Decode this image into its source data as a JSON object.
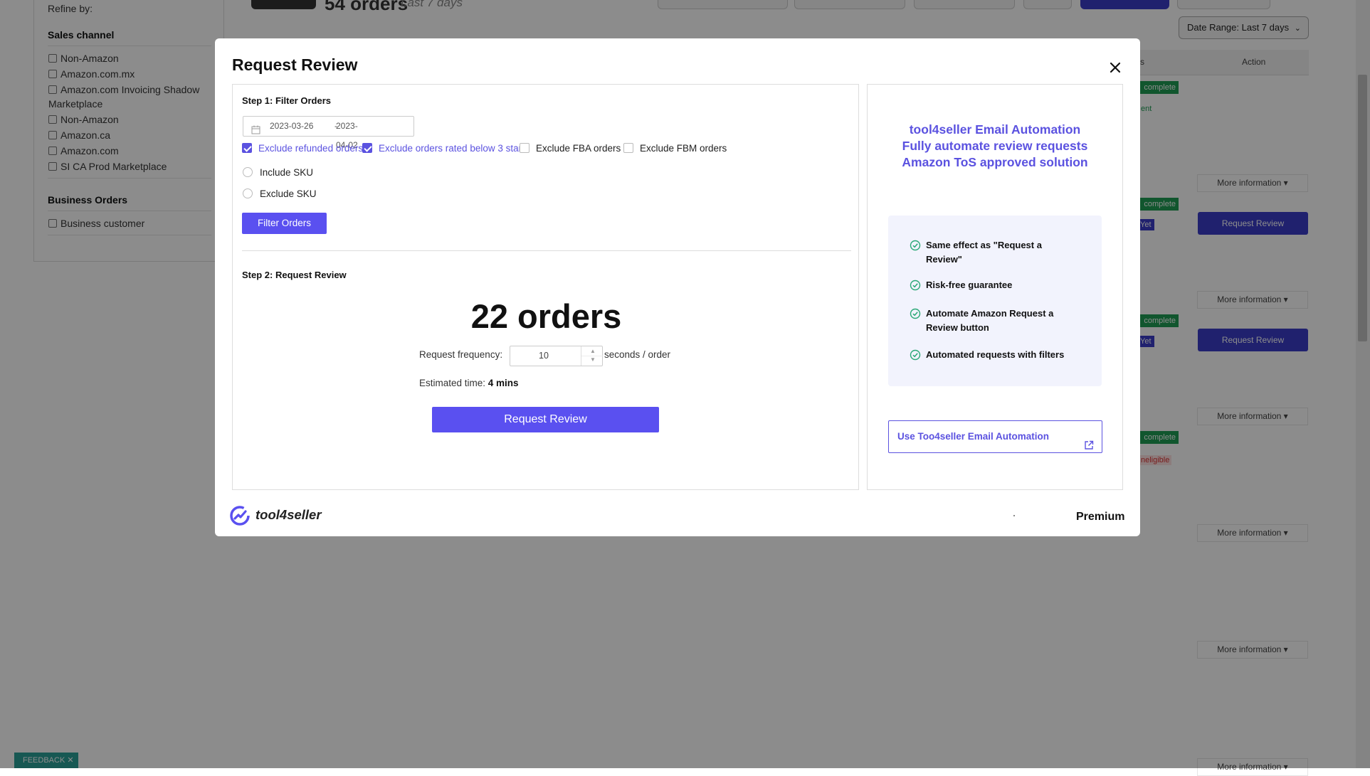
{
  "background": {
    "refine_by": "Refine by:",
    "sales_channel_title": "Sales channel",
    "sales_channels": [
      "Non-Amazon",
      "Amazon.com.mx",
      "Amazon.com Invoicing Shadow Marketplace",
      "Non-Amazon",
      "Amazon.ca",
      "Amazon.com",
      "SI CA Prod Marketplace"
    ],
    "business_orders_title": "Business Orders",
    "business_items": [
      "Business customer"
    ],
    "orders_title": "54 orders",
    "orders_subtitle": "Last 7 days",
    "date_range": "Date Range: Last 7 days",
    "col_action": "Action",
    "col_status_tail": "s",
    "more_information": "More information",
    "request_review": "Request Review",
    "status_complete": "complete",
    "status_sent": "ent",
    "status_yet": "Yet",
    "status_ineligible": "neligible",
    "feedback": "FEEDBACK"
  },
  "modal": {
    "title": "Request Review",
    "step1": {
      "title": "Step 1: Filter Orders",
      "date_start": "2023-03-26",
      "date_sep": "-",
      "date_end": "2023-04-02",
      "checkboxes": [
        {
          "label": "Exclude refunded orders",
          "checked": true
        },
        {
          "label": "Exclude orders rated below 3 stars",
          "checked": true
        },
        {
          "label": "Exclude FBA orders",
          "checked": false
        },
        {
          "label": "Exclude FBM orders",
          "checked": false
        }
      ],
      "radios": [
        "Include SKU",
        "Exclude SKU"
      ],
      "filter_button": "Filter Orders"
    },
    "step2": {
      "title": "Step 2: Request Review",
      "order_count": "22 orders",
      "frequency_label": "Request frequency:",
      "frequency_value": "10",
      "frequency_unit": "seconds / order",
      "estimated_label": "Estimated time:",
      "estimated_value": "4 mins",
      "request_button": "Request Review"
    },
    "promo": {
      "line1": "tool4seller Email Automation",
      "line2": "Fully automate review requests",
      "line3": "Amazon ToS approved solution",
      "features": [
        "Same effect as \"Request a Review\"",
        "Risk-free guarantee",
        "Automate Amazon Request a Review button",
        "Automated requests with filters"
      ],
      "use_button": "Use Too4seller Email Automation"
    },
    "brand": "tool4seller",
    "plan": "Premium"
  },
  "colors": {
    "accent": "#5a50f0",
    "accent_text": "#5b52e0",
    "feature_bg": "#f2f3fd",
    "status_green": "#1f9d55",
    "check_green": "#2aa876",
    "background_button": "#3b3dc8"
  }
}
